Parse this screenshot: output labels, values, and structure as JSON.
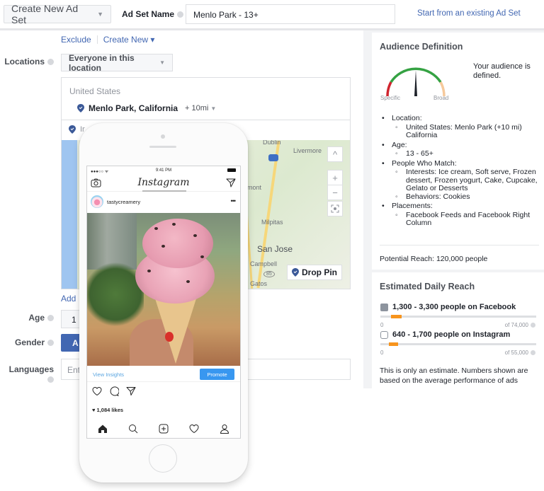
{
  "topbar": {
    "create_select": "Create New Ad Set",
    "adset_name_label": "Ad Set Name",
    "adset_name_value": "Menlo Park - 13+",
    "start_existing_link": "Start from an existing Ad Set"
  },
  "form": {
    "exclude_link": "Exclude",
    "create_new_link": "Create New ▾",
    "locations_label": "Locations",
    "location_type_select": "Everyone in this location",
    "location_country": "United States",
    "location_city": "Menlo Park, California",
    "location_radius": "+ 10mi",
    "location_include_partial": "Ir",
    "map": {
      "labels": [
        "Dublin",
        "Livermore",
        "mont",
        "Milpitas",
        "San Jose",
        "Campbell",
        "85",
        "Gatos"
      ],
      "zoom_up": "^",
      "zoom_in": "+",
      "zoom_out": "−",
      "drop_pin": "Drop Pin"
    },
    "add_link": "Add",
    "age_label": "Age",
    "age_value": "1",
    "gender_label": "Gender",
    "gender_value": "A",
    "languages_label": "Languages",
    "languages_placeholder": "Ent"
  },
  "audience": {
    "title": "Audience Definition",
    "gauge_left": "Specific",
    "gauge_right": "Broad",
    "gauge_level_fraction": 0.5,
    "status": "Your audience is defined.",
    "items": [
      {
        "label": "Location:",
        "sub": [
          "United States: Menlo Park (+10 mi) California"
        ]
      },
      {
        "label": "Age:",
        "sub": [
          "13 - 65+"
        ]
      },
      {
        "label": "People Who Match:",
        "sub": [
          "Interests: Ice cream, Soft serve, Frozen dessert, Frozen yogurt, Cake, Cupcake, Gelato or Desserts",
          "Behaviors: Cookies"
        ]
      },
      {
        "label": "Placements:",
        "sub": [
          "Facebook Feeds and Facebook Right Column"
        ]
      }
    ],
    "potential_reach": "Potential Reach: 120,000 people"
  },
  "reach": {
    "title": "Estimated Daily Reach",
    "facebook": {
      "label": "1,300 - 3,300 people on Facebook",
      "min_label": "0",
      "max_label": "of 74,000",
      "range_start": 1300,
      "range_end": 3300,
      "max": 74000,
      "color": "#f7941d"
    },
    "instagram": {
      "label": "640 - 1,700 people on Instagram",
      "min_label": "0",
      "max_label": "of 55,000",
      "range_start": 640,
      "range_end": 1700,
      "max": 55000,
      "color": "#f7941d"
    },
    "note": "This is only an estimate. Numbers shown are based on the average performance of ads"
  },
  "phone": {
    "time": "9:41 PM",
    "signal": "●●●○○ ᯤ",
    "app_title": "Instagram",
    "username": "tastycreamery",
    "more": "•••",
    "view_insights": "View Insights",
    "promote": "Promote",
    "likes": "♥ 1,084 likes"
  }
}
